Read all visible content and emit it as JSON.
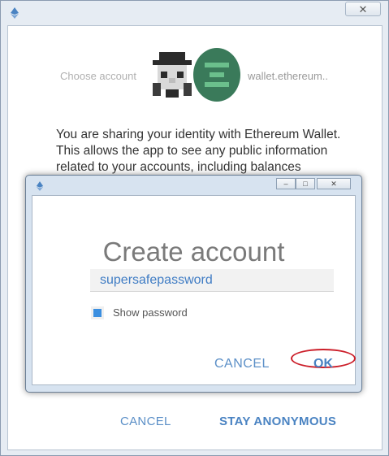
{
  "outer": {
    "close_glyph": "✕",
    "choose_account": "Choose account",
    "wallet_label": "wallet.ethereum..",
    "sharing_text": "You are sharing your identity with Ethereum Wallet. This allows the app to see any public information related to your accounts, including balances",
    "cancel_label": "CANCEL",
    "stay_anonymous_label": "STAY ANONYMOUS"
  },
  "dialog": {
    "title": "Create account",
    "password_value": "supersafepassword",
    "show_password_label": "Show password",
    "show_password_checked": true,
    "cancel_label": "CANCEL",
    "ok_label": "OK",
    "min_glyph": "–",
    "max_glyph": "□",
    "close_glyph": "✕"
  },
  "colors": {
    "accent": "#4a83c2",
    "highlight_circle": "#cc1f2a",
    "identicon_green": "#3a7a5a"
  },
  "icons": {
    "app_icon": "ethereum-icon",
    "identicon_pixel": "pixel-avatar-icon",
    "identicon_green": "green-identicon-icon"
  }
}
